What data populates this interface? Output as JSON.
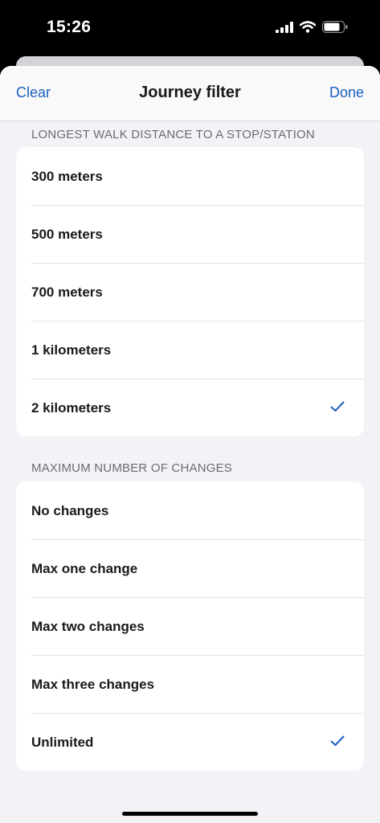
{
  "status_bar": {
    "time": "15:26"
  },
  "nav": {
    "left_label": "Clear",
    "title": "Journey filter",
    "right_label": "Done"
  },
  "walk_section": {
    "header": "LONGEST WALK DISTANCE TO A STOP/STATION",
    "items": [
      {
        "label": "300 meters",
        "selected": false
      },
      {
        "label": "500 meters",
        "selected": false
      },
      {
        "label": "700 meters",
        "selected": false
      },
      {
        "label": "1 kilometers",
        "selected": false
      },
      {
        "label": "2 kilometers",
        "selected": true
      }
    ]
  },
  "changes_section": {
    "header": "MAXIMUM NUMBER OF CHANGES",
    "items": [
      {
        "label": "No changes",
        "selected": false
      },
      {
        "label": "Max one change",
        "selected": false
      },
      {
        "label": "Max two changes",
        "selected": false
      },
      {
        "label": "Max three changes",
        "selected": false
      },
      {
        "label": "Unlimited",
        "selected": true
      }
    ]
  },
  "colors": {
    "accent": "#1a5fbf",
    "background": "#f2f2f7"
  },
  "icons": {
    "checkmark": "checkmark-icon"
  }
}
